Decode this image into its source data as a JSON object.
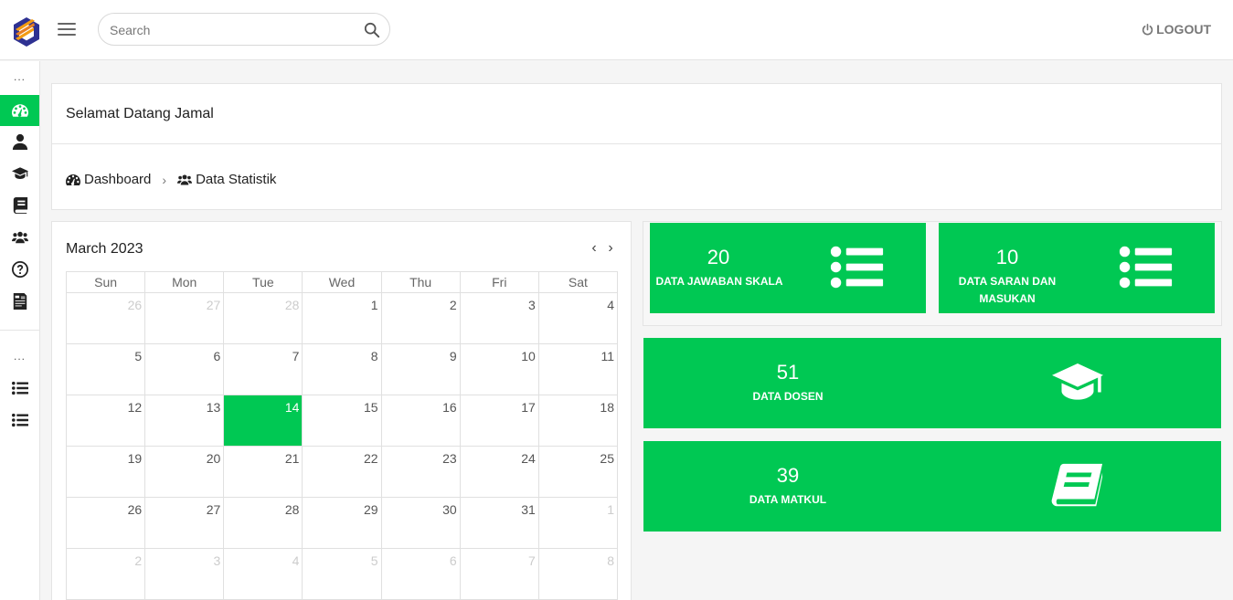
{
  "topbar": {
    "search_placeholder": "Search",
    "logout_label": "LOGOUT",
    "logo_colors": [
      "#f39c12",
      "#2e3192"
    ]
  },
  "sidebar": {
    "section_dots": [
      "...",
      "..."
    ],
    "items": [
      {
        "icon": "dashboard-icon",
        "active": true
      },
      {
        "icon": "user-icon",
        "active": false
      },
      {
        "icon": "graduation-cap-icon",
        "active": false
      },
      {
        "icon": "book-icon",
        "active": false
      },
      {
        "icon": "users-icon",
        "active": false
      },
      {
        "icon": "question-circle-icon",
        "active": false
      },
      {
        "icon": "report-icon",
        "active": false
      },
      {
        "icon": "list-icon",
        "active": false
      },
      {
        "icon": "list-icon",
        "active": false
      }
    ]
  },
  "welcome": {
    "title": "Selamat Datang Jamal",
    "breadcrumb": [
      {
        "label": "Dashboard",
        "icon": "dashboard-icon"
      },
      {
        "label": "Data Statistik",
        "icon": "users-icon"
      }
    ]
  },
  "calendar": {
    "title": "March 2023",
    "weekdays": [
      "Sun",
      "Mon",
      "Tue",
      "Wed",
      "Thu",
      "Fri",
      "Sat"
    ],
    "weeks": [
      [
        {
          "d": "26",
          "m": true
        },
        {
          "d": "27",
          "m": true
        },
        {
          "d": "28",
          "m": true
        },
        {
          "d": "1"
        },
        {
          "d": "2"
        },
        {
          "d": "3"
        },
        {
          "d": "4"
        }
      ],
      [
        {
          "d": "5"
        },
        {
          "d": "6"
        },
        {
          "d": "7"
        },
        {
          "d": "8"
        },
        {
          "d": "9"
        },
        {
          "d": "10"
        },
        {
          "d": "11"
        }
      ],
      [
        {
          "d": "12"
        },
        {
          "d": "13"
        },
        {
          "d": "14",
          "today": true
        },
        {
          "d": "15"
        },
        {
          "d": "16"
        },
        {
          "d": "17"
        },
        {
          "d": "18"
        }
      ],
      [
        {
          "d": "19"
        },
        {
          "d": "20"
        },
        {
          "d": "21"
        },
        {
          "d": "22"
        },
        {
          "d": "23"
        },
        {
          "d": "24"
        },
        {
          "d": "25"
        }
      ],
      [
        {
          "d": "26"
        },
        {
          "d": "27"
        },
        {
          "d": "28"
        },
        {
          "d": "29"
        },
        {
          "d": "30"
        },
        {
          "d": "31"
        },
        {
          "d": "1",
          "m": true
        }
      ],
      [
        {
          "d": "2",
          "m": true
        },
        {
          "d": "3",
          "m": true
        },
        {
          "d": "4",
          "m": true
        },
        {
          "d": "5",
          "m": true
        },
        {
          "d": "6",
          "m": true
        },
        {
          "d": "7",
          "m": true
        },
        {
          "d": "8",
          "m": true
        }
      ]
    ],
    "prev_icon": "chevron-left-icon",
    "next_icon": "chevron-right-icon"
  },
  "stats": {
    "jawaban": {
      "value": "20",
      "label": "DATA JAWABAN SKALA",
      "icon": "list-icon"
    },
    "saran": {
      "value": "10",
      "label_line1": "DATA SARAN DAN",
      "label_line2": "MASUKAN",
      "icon": "list-icon"
    },
    "dosen": {
      "value": "51",
      "label": "DATA DOSEN",
      "icon": "graduation-cap-icon"
    },
    "matkul": {
      "value": "39",
      "label": "DATA MATKUL",
      "icon": "book-icon"
    }
  },
  "colors": {
    "accent": "#00c853",
    "text": "#222222"
  }
}
